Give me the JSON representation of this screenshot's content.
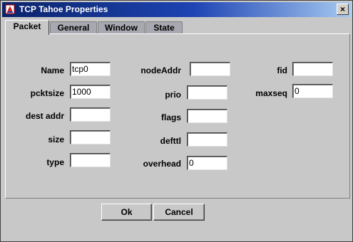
{
  "window": {
    "title": "TCP Tahoe Properties",
    "close_glyph": "×"
  },
  "tabs": [
    {
      "label": "Packet",
      "active": true
    },
    {
      "label": "General",
      "active": false
    },
    {
      "label": "Window",
      "active": false
    },
    {
      "label": "State",
      "active": false
    }
  ],
  "form": {
    "name": {
      "label": "Name",
      "value": "tcp0"
    },
    "pcktsize": {
      "label": "pcktsize",
      "value": "1000"
    },
    "dest_addr": {
      "label": "dest addr",
      "value": ""
    },
    "size": {
      "label": "size",
      "value": ""
    },
    "type": {
      "label": "type",
      "value": ""
    },
    "nodeaddr": {
      "label": "nodeAddr",
      "value": ""
    },
    "prio": {
      "label": "prio",
      "value": ""
    },
    "flags": {
      "label": "flags",
      "value": ""
    },
    "defttl": {
      "label": "defttl",
      "value": ""
    },
    "overhead": {
      "label": "overhead",
      "value": "0"
    },
    "fid": {
      "label": "fid",
      "value": ""
    },
    "maxseq": {
      "label": "maxseq",
      "value": "0"
    }
  },
  "buttons": {
    "ok": "Ok",
    "cancel": "Cancel"
  },
  "icons": {
    "app": "app-icon",
    "close": "close-icon"
  }
}
